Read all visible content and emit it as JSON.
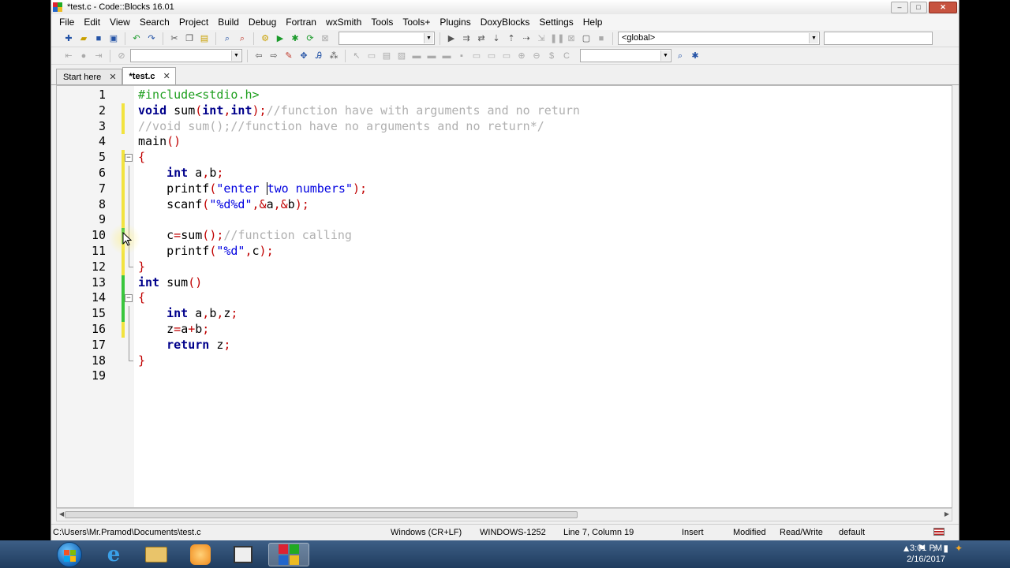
{
  "window": {
    "title": "*test.c - Code::Blocks 16.01",
    "minimize": "–",
    "maximize": "□",
    "close": "✕"
  },
  "menu": [
    "File",
    "Edit",
    "View",
    "Search",
    "Project",
    "Build",
    "Debug",
    "Fortran",
    "wxSmith",
    "Tools",
    "Tools+",
    "Plugins",
    "DoxyBlocks",
    "Settings",
    "Help"
  ],
  "toolbar": {
    "scope_value": "<global>",
    "target_value": "",
    "search_value": ""
  },
  "tabs": [
    {
      "label": "Start here",
      "close": "✕",
      "active": false
    },
    {
      "label": "*test.c",
      "close": "✕",
      "active": true
    }
  ],
  "code_lines": [
    {
      "num": "1",
      "text": "#include<stdio.h>"
    },
    {
      "num": "2",
      "text": "void sum(int,int);//function have with arguments and no return"
    },
    {
      "num": "3",
      "text": "//void sum();//function have no arguments and no return*/"
    },
    {
      "num": "4",
      "text": "main()"
    },
    {
      "num": "5",
      "text": "{"
    },
    {
      "num": "6",
      "text": "    int a,b;"
    },
    {
      "num": "7",
      "text": "    printf(\"enter two numbers\");"
    },
    {
      "num": "8",
      "text": "    scanf(\"%d%d\",&a,&b);"
    },
    {
      "num": "9",
      "text": ""
    },
    {
      "num": "10",
      "text": "    c=sum();//function calling"
    },
    {
      "num": "11",
      "text": "    printf(\"%d\",c);"
    },
    {
      "num": "12",
      "text": "}"
    },
    {
      "num": "13",
      "text": "int sum()"
    },
    {
      "num": "14",
      "text": "{"
    },
    {
      "num": "15",
      "text": "    int a,b,z;"
    },
    {
      "num": "16",
      "text": "    z=a+b;"
    },
    {
      "num": "17",
      "text": "    return z;"
    },
    {
      "num": "18",
      "text": "}"
    },
    {
      "num": "19",
      "text": ""
    }
  ],
  "status": {
    "path": "C:\\Users\\Mr.Pramod\\Documents\\test.c",
    "eol": "Windows (CR+LF)",
    "encoding": "WINDOWS-1252",
    "position": "Line 7, Column 19",
    "mode": "Insert",
    "modified": "Modified",
    "access": "Read/Write",
    "lang": "default"
  },
  "taskbar": {
    "time": "3:01 PM",
    "date": "2/16/2017"
  },
  "colors": {
    "keyword": "#00008b",
    "preprocessor": "#1f9f1f",
    "comment": "#b0b0b0",
    "operator": "#c00000",
    "string": "#0000e0",
    "change_marker_saved": "#39c63d",
    "change_marker_unsaved": "#f2e33f"
  }
}
